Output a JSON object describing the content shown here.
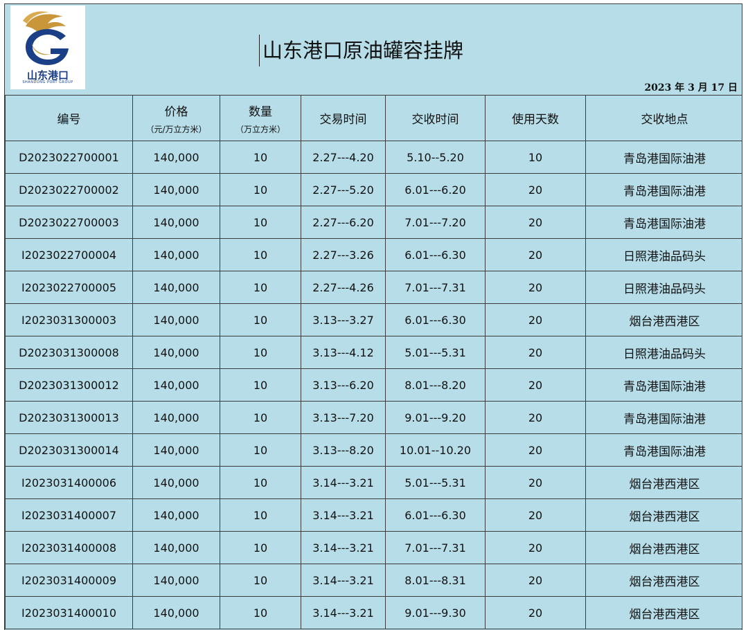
{
  "header": {
    "logo_text": "山东港口",
    "logo_subtext": "SHANDONG PORT GROUP",
    "title": "山东港口原油罐容挂牌",
    "date": "2023 年 3 月 17 日"
  },
  "table": {
    "columns": [
      {
        "label": "编号",
        "unit": ""
      },
      {
        "label": "价格",
        "unit": "（元/万立方米）"
      },
      {
        "label": "数量",
        "unit": "（万立方米）"
      },
      {
        "label": "交易时间",
        "unit": ""
      },
      {
        "label": "交收时间",
        "unit": ""
      },
      {
        "label": "使用天数",
        "unit": ""
      },
      {
        "label": "交收地点",
        "unit": ""
      }
    ],
    "rows": [
      [
        "D2023022700001",
        "140,000",
        "10",
        "2.27---4.20",
        "5.10--5.20",
        "10",
        "青岛港国际油港"
      ],
      [
        "D2023022700002",
        "140,000",
        "10",
        "2.27---5.20",
        "6.01---6.20",
        "20",
        "青岛港国际油港"
      ],
      [
        "D2023022700003",
        "140,000",
        "10",
        "2.27---6.20",
        "7.01---7.20",
        "20",
        "青岛港国际油港"
      ],
      [
        "I2023022700004",
        "140,000",
        "10",
        "2.27---3.26",
        "6.01---6.30",
        "20",
        "日照港油品码头"
      ],
      [
        "I2023022700005",
        "140,000",
        "10",
        "2.27---4.26",
        "7.01---7.31",
        "20",
        "日照港油品码头"
      ],
      [
        "I2023031300003",
        "140,000",
        "10",
        "3.13---3.27",
        "6.01---6.30",
        "20",
        "烟台港西港区"
      ],
      [
        "D2023031300008",
        "140,000",
        "10",
        "3.13---4.12",
        "5.01---5.31",
        "20",
        "日照港油品码头"
      ],
      [
        "D2023031300012",
        "140,000",
        "10",
        "3.13---6.20",
        "8.01---8.20",
        "20",
        "青岛港国际油港"
      ],
      [
        "D2023031300013",
        "140,000",
        "10",
        "3.13---7.20",
        "9.01---9.20",
        "20",
        "青岛港国际油港"
      ],
      [
        "D2023031300014",
        "140,000",
        "10",
        "3.13---8.20",
        "10.01--10.20",
        "20",
        "青岛港国际油港"
      ],
      [
        "I2023031400006",
        "140,000",
        "10",
        "3.14---3.21",
        "5.01---5.31",
        "20",
        "烟台港西港区"
      ],
      [
        "I2023031400007",
        "140,000",
        "10",
        "3.14---3.21",
        "6.01---6.30",
        "20",
        "烟台港西港区"
      ],
      [
        "I2023031400008",
        "140,000",
        "10",
        "3.14---3.21",
        "7.01---7.31",
        "20",
        "烟台港西港区"
      ],
      [
        "I2023031400009",
        "140,000",
        "10",
        "3.14---3.21",
        "8.01---8.31",
        "20",
        "烟台港西港区"
      ],
      [
        "I2023031400010",
        "140,000",
        "10",
        "3.14---3.21",
        "9.01---9.30",
        "20",
        "烟台港西港区"
      ]
    ]
  },
  "colors": {
    "background": "#b7dde8",
    "logo_gold": "#c9963a",
    "logo_blue": "#1a3f86",
    "grid_line": "#3c3c3c"
  }
}
